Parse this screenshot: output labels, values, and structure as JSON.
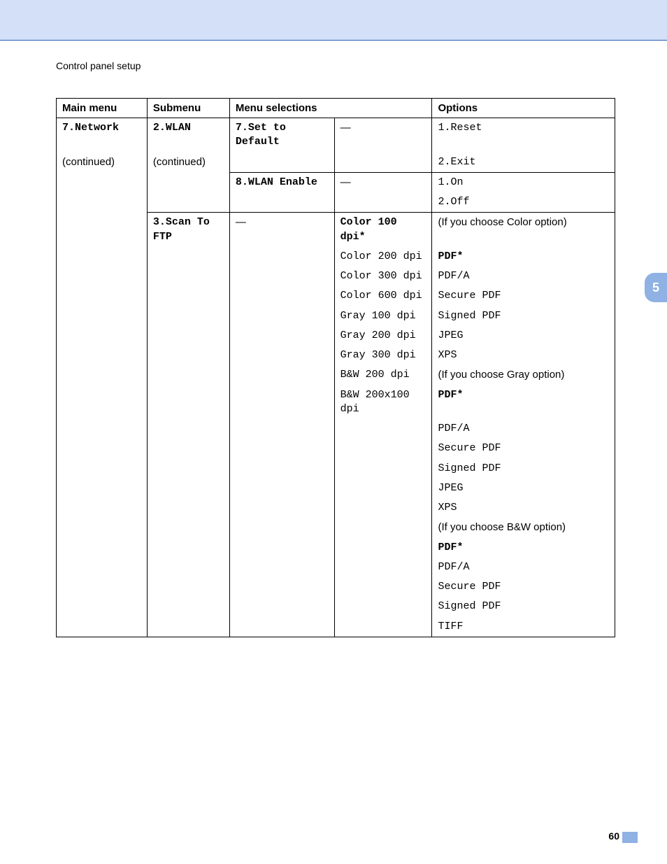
{
  "header": {
    "section_title": "Control panel setup"
  },
  "chapter_tab": "5",
  "page_number": "60",
  "table": {
    "headers": {
      "main_menu": "Main menu",
      "submenu": "Submenu",
      "menu_selections": "Menu selections",
      "options": "Options"
    },
    "main_menu": {
      "title": "7.Network",
      "note": "(continued)"
    },
    "submenu_wlan": {
      "title": "2.WLAN",
      "note": "(continued)"
    },
    "sel_set_default": "7.Set to Default",
    "sel_wlan_enable": "8.WLAN Enable",
    "dash": "—",
    "opts_set_default": [
      "1.Reset",
      "2.Exit"
    ],
    "opts_wlan_enable": [
      "1.On",
      "2.Off"
    ],
    "submenu_scan": "3.Scan To FTP",
    "scan_selections": [
      {
        "text": "Color 100 dpi*",
        "bold": true
      },
      {
        "text": "Color 200 dpi",
        "bold": false
      },
      {
        "text": "Color 300 dpi",
        "bold": false
      },
      {
        "text": "Color 600 dpi",
        "bold": false
      },
      {
        "text": "Gray 100 dpi",
        "bold": false
      },
      {
        "text": "Gray 200 dpi",
        "bold": false
      },
      {
        "text": "Gray 300 dpi",
        "bold": false
      },
      {
        "text": "B&W 200 dpi",
        "bold": false
      },
      {
        "text": "B&W 200x100 dpi",
        "bold": false
      }
    ],
    "scan_options": [
      {
        "text": "(If you choose Color option)",
        "mono": false,
        "bold": false
      },
      {
        "text": "PDF*",
        "mono": true,
        "bold": true
      },
      {
        "text": "PDF/A",
        "mono": true,
        "bold": false
      },
      {
        "text": "Secure PDF",
        "mono": true,
        "bold": false
      },
      {
        "text": "Signed PDF",
        "mono": true,
        "bold": false
      },
      {
        "text": "JPEG",
        "mono": true,
        "bold": false
      },
      {
        "text": "XPS",
        "mono": true,
        "bold": false
      },
      {
        "text": "(If you choose Gray option)",
        "mono": false,
        "bold": false
      },
      {
        "text": "PDF*",
        "mono": true,
        "bold": true
      },
      {
        "text": "PDF/A",
        "mono": true,
        "bold": false
      },
      {
        "text": "Secure PDF",
        "mono": true,
        "bold": false
      },
      {
        "text": "Signed PDF",
        "mono": true,
        "bold": false
      },
      {
        "text": "JPEG",
        "mono": true,
        "bold": false
      },
      {
        "text": "XPS",
        "mono": true,
        "bold": false
      },
      {
        "text": "(If you choose B&W option)",
        "mono": false,
        "bold": false
      },
      {
        "text": "PDF*",
        "mono": true,
        "bold": true
      },
      {
        "text": "PDF/A",
        "mono": true,
        "bold": false
      },
      {
        "text": "Secure PDF",
        "mono": true,
        "bold": false
      },
      {
        "text": "Signed PDF",
        "mono": true,
        "bold": false
      },
      {
        "text": "TIFF",
        "mono": true,
        "bold": false
      }
    ]
  }
}
